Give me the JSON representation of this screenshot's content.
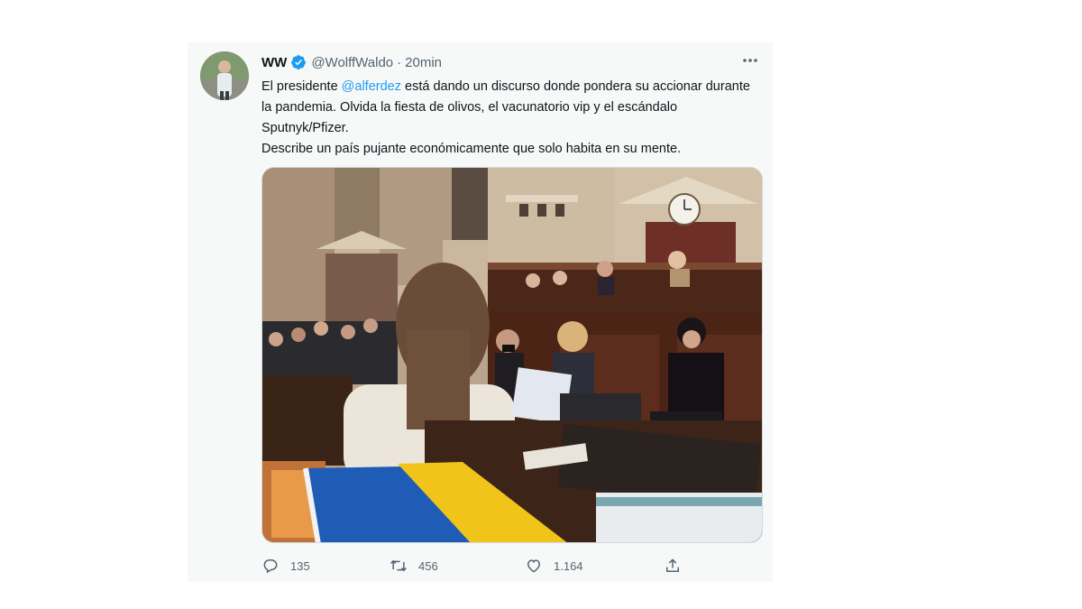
{
  "tweet": {
    "display_name": "WW",
    "handle": "@WolffWaldo",
    "separator": "·",
    "time": "20min",
    "text_parts": {
      "line1_prefix": "El presidente ",
      "mention": "@alferdez",
      "line1_suffix": " está dando un discurso donde pondera su accionar durante la pandemia. Olvida la fiesta de olivos, el vacunatorio vip y el escándalo Sputnyk/Pfizer.",
      "line2": "Describe un país pujante económicamente que solo habita en su mente."
    },
    "stats": {
      "replies": "135",
      "retweets": "456",
      "likes": "1.164"
    }
  },
  "icons": {
    "verified": "verified-badge-icon",
    "more": "more-options-icon",
    "reply": "reply-icon",
    "retweet": "retweet-icon",
    "like": "heart-icon",
    "share": "share-icon"
  },
  "colors": {
    "accent": "#1d9bf0",
    "text": "#0f1419",
    "muted": "#536471",
    "card_bg": "#f7f9f9"
  }
}
